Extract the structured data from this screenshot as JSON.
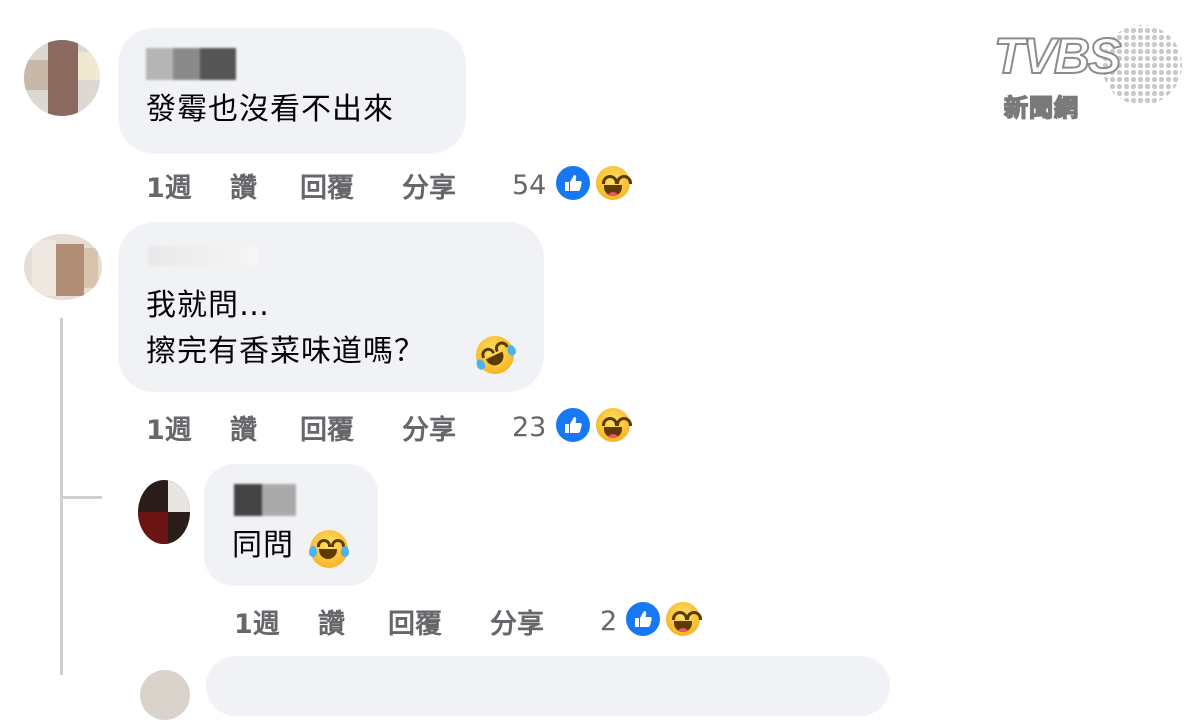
{
  "comments": [
    {
      "text_lines": [
        "發霉也沒看不出來"
      ],
      "actions": {
        "time": "1週",
        "like": "讚",
        "reply": "回覆",
        "share": "分享"
      },
      "reaction_count": "54",
      "reactions": [
        "like-icon",
        "haha-icon"
      ]
    },
    {
      "text_lines": [
        "我就問…",
        "擦完有香菜味道嗎？"
      ],
      "inline_emoji": "rolling-on-floor-laughing-emoji",
      "actions": {
        "time": "1週",
        "like": "讚",
        "reply": "回覆",
        "share": "分享"
      },
      "reaction_count": "23",
      "reactions": [
        "like-icon",
        "haha-icon"
      ]
    },
    {
      "text_lines": [
        "同問"
      ],
      "inline_emoji": "tears-of-joy-emoji",
      "actions": {
        "time": "1週",
        "like": "讚",
        "reply": "回覆",
        "share": "分享"
      },
      "reaction_count": "2",
      "reactions": [
        "like-icon",
        "haha-icon"
      ]
    }
  ],
  "watermark": {
    "brand": "TVBS",
    "subtitle": "新聞網"
  },
  "colors": {
    "bubble": "#f0f2f5",
    "like_blue": "#1877f2",
    "meta_gray": "#65676b",
    "thread_line": "#ced0d4"
  }
}
